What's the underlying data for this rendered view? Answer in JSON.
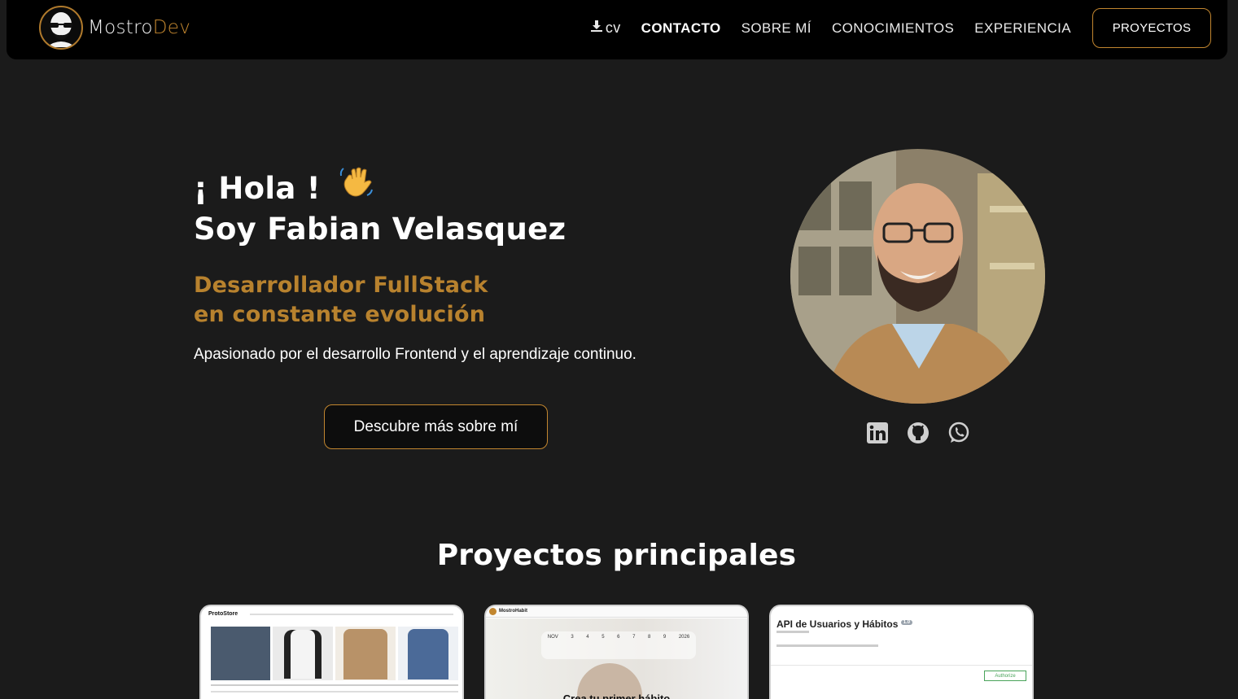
{
  "brand": {
    "name_part1": "Mostro",
    "name_part2": "Dev",
    "accent_color": "#c2862f"
  },
  "nav": {
    "cv_label": "cv",
    "contact_label": "CONTACTO",
    "about_label": "SOBRE MÍ",
    "skills_label": "CONOCIMIENTOS",
    "experience_label": "EXPERIENCIA",
    "projects_button_label": "PROYECTOS"
  },
  "hero": {
    "greeting": "¡ Hola !",
    "name_line": "Soy Fabian Velasquez",
    "role_line1": "Desarrollador FullStack",
    "role_line2": "en constante evolución",
    "description": "Apasionado por el desarrollo Frontend y el aprendizaje continuo.",
    "cta_label": "Descubre más sobre mí"
  },
  "socials": [
    "linkedin-icon",
    "github-icon",
    "whatsapp-icon"
  ],
  "projects": {
    "title": "Proyectos principales",
    "cards": [
      {
        "header": "ProtoStore"
      },
      {
        "header": "MostroHabit",
        "days": [
          "NOV",
          "3",
          "4",
          "5",
          "6",
          "7",
          "8",
          "9",
          "2026"
        ],
        "headline": "Crea tu primer hábito"
      },
      {
        "title": "API de Usuarios y Hábitos",
        "badge": "1.0",
        "auth_label": "Authorize"
      }
    ]
  }
}
